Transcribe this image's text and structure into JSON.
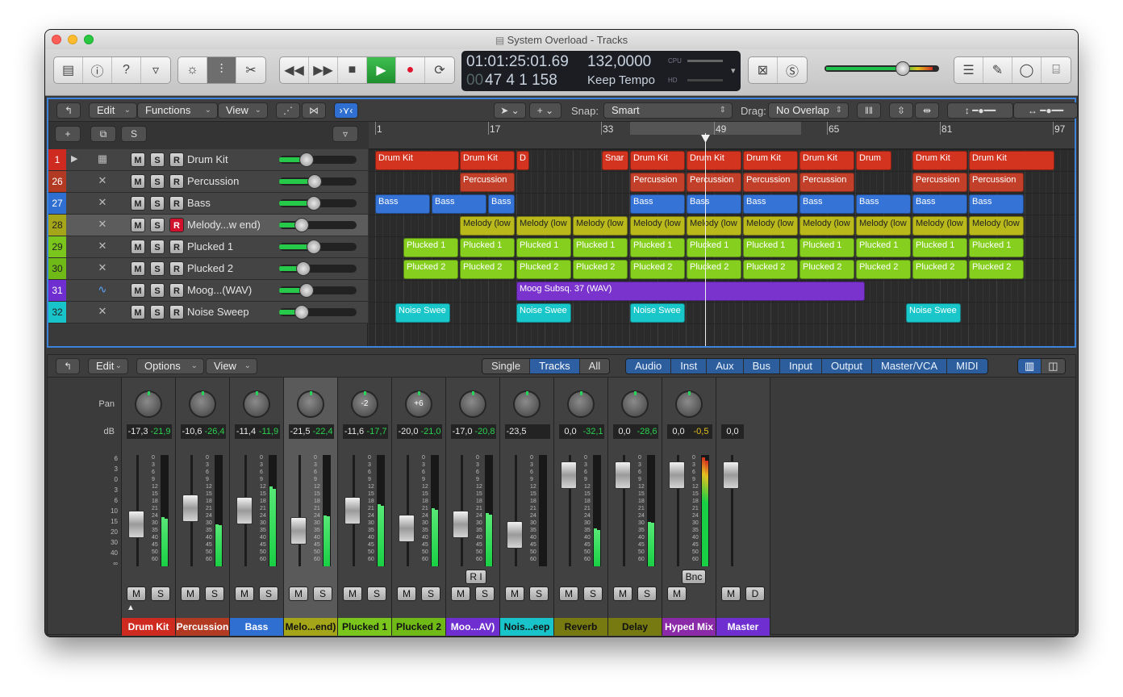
{
  "window": {
    "title": "System Overload - Tracks"
  },
  "lcd": {
    "time": "01:01:25:01.69",
    "tempo": "132,0000",
    "bars": "47  4  1  158",
    "keep": "Keep Tempo",
    "prefix": "00",
    "cpu": "CPU",
    "hd": "HD"
  },
  "tracks_toolbar": {
    "edit": "Edit",
    "functions": "Functions",
    "view": "View",
    "snap_label": "Snap:",
    "snap_value": "Smart",
    "drag_label": "Drag:",
    "drag_value": "No Overlap"
  },
  "tracks_header_buttons": {
    "add": "+",
    "s": "S"
  },
  "tracks": [
    {
      "num": "1",
      "name": "Drum Kit",
      "color": "#cf2a1f",
      "rec": false,
      "vol": 0.28
    },
    {
      "num": "26",
      "name": "Percussion",
      "color": "#b33a22",
      "rec": false,
      "vol": 0.39
    },
    {
      "num": "27",
      "name": "Bass",
      "color": "#2f6fd1",
      "rec": false,
      "vol": 0.38
    },
    {
      "num": "28",
      "name": "Melody...w end)",
      "color": "#a5a51a",
      "rec": true,
      "vol": 0.22
    },
    {
      "num": "29",
      "name": "Plucked 1",
      "color": "#7ac61c",
      "rec": false,
      "vol": 0.38
    },
    {
      "num": "30",
      "name": "Plucked 2",
      "color": "#6fba16",
      "rec": false,
      "vol": 0.24
    },
    {
      "num": "31",
      "name": "Moog...(WAV)",
      "color": "#6f2ed0",
      "rec": false,
      "vol": 0.28
    },
    {
      "num": "32",
      "name": "Noise Sweep",
      "color": "#18c3c9",
      "rec": false,
      "vol": 0.22
    }
  ],
  "ruler": [
    "1",
    "17",
    "33",
    "49",
    "65",
    "81",
    "97"
  ],
  "regions": {
    "drum": {
      "a": "Drum Kit",
      "b": "D",
      "c": "Snar",
      "d": "Drum"
    },
    "perc": "Percussion",
    "bass": "Bass",
    "melody": "Melody (low",
    "pl1": "Plucked 1",
    "pl2": "Plucked 2",
    "moog": "Moog Subsq. 37 (WAV)",
    "noise": "Noise Swee"
  },
  "mixer_toolbar": {
    "edit": "Edit",
    "options": "Options",
    "view": "View",
    "single": "Single",
    "tracks": "Tracks",
    "all": "All",
    "audio": "Audio",
    "inst": "Inst",
    "aux": "Aux",
    "bus": "Bus",
    "input": "Input",
    "output": "Output",
    "master": "Master/VCA",
    "midi": "MIDI"
  },
  "mixer_labels": {
    "pan": "Pan",
    "db": "dB",
    "scale": [
      "6",
      "3",
      "0",
      "3",
      "6",
      "10",
      "15",
      "20",
      "30",
      "40",
      "∞"
    ],
    "strip_scale": [
      "0",
      "3",
      "6",
      "9",
      "12",
      "15",
      "18",
      "21",
      "24",
      "30",
      "35",
      "40",
      "45",
      "50",
      "60"
    ]
  },
  "strips": [
    {
      "name": "Drum Kit",
      "color": "#cf2a1f",
      "db1": "-17,3",
      "db2": "-21,9",
      "pan": "",
      "knob": "",
      "fader": 0.62,
      "meter": 0.44,
      "btn1": "M",
      "btn2": "S",
      "extra": ""
    },
    {
      "name": "Percussion",
      "color": "#b33a22",
      "db1": "-10,6",
      "db2": "-26,4",
      "pan": "",
      "knob": "",
      "fader": 0.48,
      "meter": 0.38,
      "btn1": "M",
      "btn2": "S",
      "extra": ""
    },
    {
      "name": "Bass",
      "color": "#2f6fd1",
      "db1": "-11,4",
      "db2": "-11,9",
      "pan": "",
      "knob": "",
      "fader": 0.5,
      "meter": 0.72,
      "btn1": "M",
      "btn2": "S",
      "extra": ""
    },
    {
      "name": "Melo...end)",
      "color": "#a5a51a",
      "db1": "-21,5",
      "db2": "-22,4",
      "pan": "",
      "knob": "",
      "fader": 0.68,
      "meter": 0.46,
      "btn1": "M",
      "btn2": "S",
      "extra": ""
    },
    {
      "name": "Plucked 1",
      "color": "#7ac61c",
      "db1": "-11,6",
      "db2": "-17,7",
      "pan": "-2",
      "knob": "-2",
      "fader": 0.5,
      "meter": 0.56,
      "btn1": "M",
      "btn2": "S",
      "extra": ""
    },
    {
      "name": "Plucked 2",
      "color": "#6fba16",
      "db1": "-20,0",
      "db2": "-21,0",
      "pan": "+6",
      "knob": "+6",
      "fader": 0.66,
      "meter": 0.52,
      "btn1": "M",
      "btn2": "S",
      "extra": ""
    },
    {
      "name": "Moo...AV)",
      "color": "#6f2ed0",
      "db1": "-17,0",
      "db2": "-20,8",
      "pan": "",
      "knob": "",
      "fader": 0.62,
      "meter": 0.48,
      "btn1": "M",
      "btn2": "S",
      "extra": "R  I"
    },
    {
      "name": "Nois...eep",
      "color": "#18c3c9",
      "db1": "-23,5",
      "db2": "",
      "pan": "",
      "knob": "",
      "fader": 0.72,
      "meter": 0.0,
      "btn1": "M",
      "btn2": "S",
      "extra": ""
    },
    {
      "name": "Reverb",
      "color": "#777a10",
      "db1": "0,0",
      "db2": "-32,1",
      "pan": "",
      "knob": "",
      "fader": 0.18,
      "meter": 0.34,
      "btn1": "M",
      "btn2": "S",
      "extra": ""
    },
    {
      "name": "Delay",
      "color": "#777a10",
      "db1": "0,0",
      "db2": "-28,6",
      "pan": "",
      "knob": "",
      "fader": 0.18,
      "meter": 0.4,
      "btn1": "M",
      "btn2": "S",
      "extra": ""
    },
    {
      "name": "Hyped Mix",
      "color": "#8a2aa8",
      "db1": "0,0",
      "db2": "-0,5",
      "pan": "",
      "knob": "",
      "fader": 0.18,
      "meter": 0.98,
      "btn1": "M",
      "btn2": "",
      "extra": "Bnc"
    },
    {
      "name": "Master",
      "color": "#6f2ed0",
      "db1": "0,0",
      "db2": "",
      "pan": "",
      "knob": "",
      "fader": 0.18,
      "meter": 0.0,
      "btn1": "M",
      "btn2": "D",
      "extra": ""
    }
  ]
}
